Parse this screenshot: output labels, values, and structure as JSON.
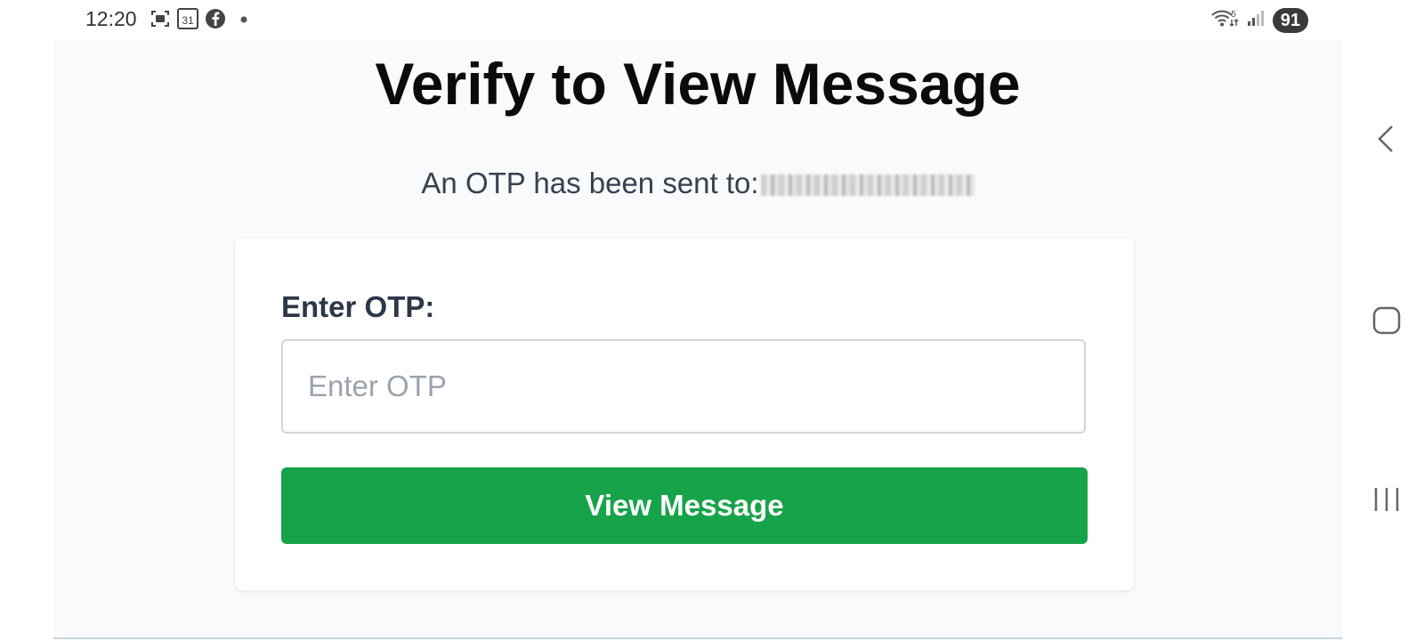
{
  "status_bar": {
    "time": "12:20",
    "calendar_day": "31",
    "notification_icons": [
      "screenshot-icon",
      "calendar-icon",
      "facebook-icon",
      "dot-icon"
    ],
    "network": "5",
    "battery": "91"
  },
  "page": {
    "title": "Verify to View Message",
    "sent_text": "An OTP has been sent to:"
  },
  "form": {
    "label": "Enter OTP:",
    "input_value": "",
    "input_placeholder": "Enter OTP",
    "button_label": "View Message"
  },
  "navigation": [
    "back-icon",
    "home-icon",
    "recents-icon"
  ],
  "colors": {
    "button": "#17a34a",
    "page_bg": "#f9fafb",
    "card_bg": "#ffffff"
  }
}
